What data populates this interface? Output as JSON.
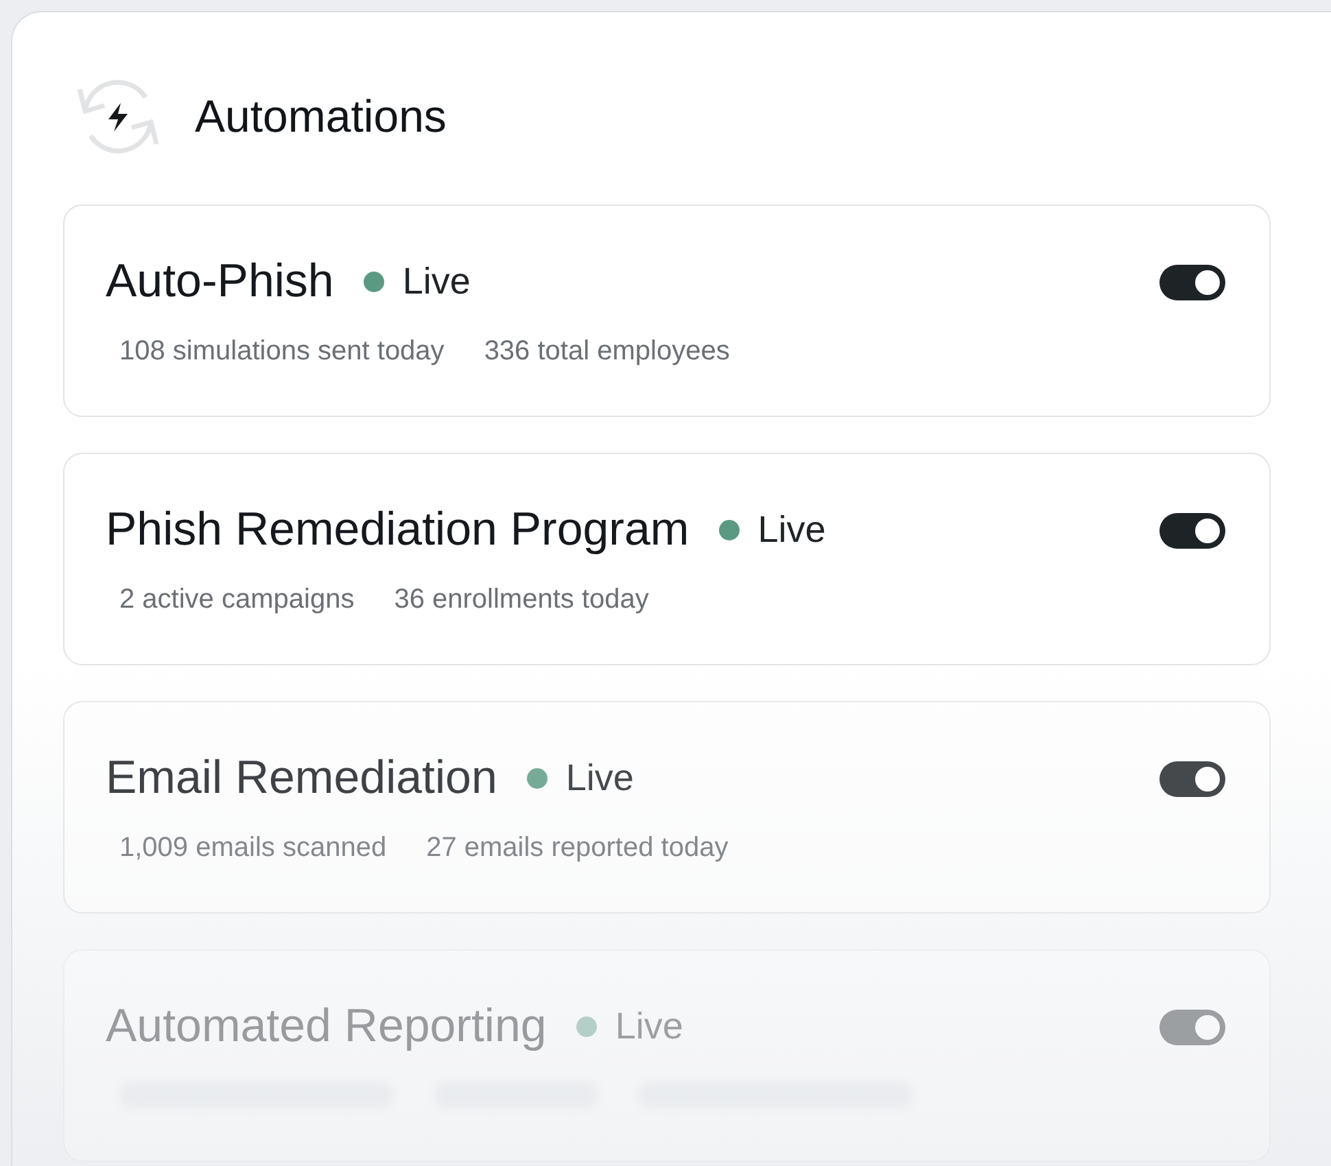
{
  "header": {
    "title": "Automations"
  },
  "automations": [
    {
      "name": "Auto-Phish",
      "status": "Live",
      "on": true,
      "stats": [
        "108 simulations sent today",
        "336 total employees"
      ]
    },
    {
      "name": "Phish Remediation Program",
      "status": "Live",
      "on": true,
      "stats": [
        "2 active campaigns",
        "36 enrollments today"
      ]
    },
    {
      "name": "Email Remediation",
      "status": "Live",
      "on": true,
      "stats": [
        "1,009 emails scanned",
        "27 emails reported today"
      ]
    },
    {
      "name": "Automated Reporting",
      "status": "Live",
      "on": true,
      "loading": true
    }
  ]
}
